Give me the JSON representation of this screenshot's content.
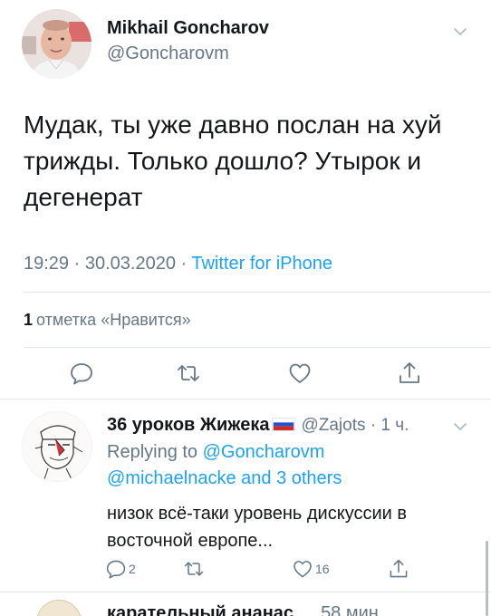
{
  "main_tweet": {
    "author_name": "Mikhail Goncharov",
    "author_handle": "@Goncharovm",
    "text": "Мудак, ты уже давно послан на хуй трижды. Только дошло? Утырок и дегенерат",
    "time": "19:29",
    "date": "30.03.2020",
    "source": "Twitter for iPhone",
    "likes_count": "1",
    "likes_label": "отметка «Нравится»"
  },
  "reply_tweet": {
    "author_name": "36 уроков Жижека",
    "flag": "russia-flag",
    "author_handle": "@Zajots",
    "age": "1 ч.",
    "replying_to_label": "Replying to",
    "replying_to_handle": "@Goncharovm",
    "mentions": "@michaelnacke and 3 others",
    "text": "низок всё-таки уровень дискуссии в восточной европе...",
    "reply_count": "2",
    "like_count": "16"
  },
  "next_tweet": {
    "author_name_partial": "карательный ананас",
    "time_partial": "58 мин"
  },
  "colors": {
    "text": "#14171a",
    "secondary": "#657786",
    "link": "#1da1f2",
    "divider": "#e1e8ed"
  },
  "icons": [
    "chevron-down-icon",
    "reply-icon",
    "retweet-icon",
    "like-icon",
    "share-icon"
  ]
}
